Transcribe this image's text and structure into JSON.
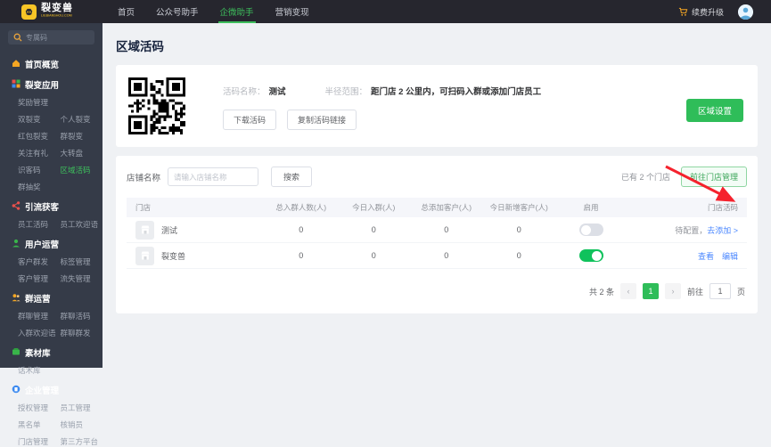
{
  "header": {
    "logo_title": "裂变兽",
    "logo_subtitle": "LIEBIANSHOU.COM",
    "nav": [
      {
        "label": "首页",
        "active": false
      },
      {
        "label": "公众号助手",
        "active": false
      },
      {
        "label": "企微助手",
        "active": true
      },
      {
        "label": "营销变现",
        "active": false
      }
    ],
    "upgrade_label": "续费升级",
    "cart_icon": "cart-icon",
    "avatar_icon": "user-avatar"
  },
  "sidebar": {
    "search_placeholder": "专属码",
    "search_icon": "search-icon",
    "active_item": "区域活码",
    "sections": [
      {
        "title": "首页概览",
        "icon": "home-icon",
        "rows": []
      },
      {
        "title": "裂变应用",
        "icon": "apps-icon",
        "rows": [
          [
            "奖励管理"
          ],
          [
            "双裂变",
            "个人裂变"
          ],
          [
            "红包裂变",
            "群裂变"
          ],
          [
            "关注有礼",
            "大转盘"
          ],
          [
            "识客码",
            "区域活码"
          ],
          [
            "群抽奖"
          ]
        ]
      },
      {
        "title": "引流获客",
        "icon": "traffic-icon",
        "rows": [
          [
            "员工活码",
            "员工欢迎语"
          ]
        ]
      },
      {
        "title": "用户运营",
        "icon": "users-icon",
        "rows": [
          [
            "客户群发",
            "标签管理"
          ],
          [
            "客户管理",
            "流失管理"
          ]
        ]
      },
      {
        "title": "群运营",
        "icon": "group-icon",
        "rows": [
          [
            "群聊管理",
            "群聊活码"
          ],
          [
            "入群欢迎语",
            "群聊群发"
          ]
        ]
      },
      {
        "title": "素材库",
        "icon": "material-icon",
        "rows": [
          [
            "话术库"
          ]
        ]
      },
      {
        "title": "企业管理",
        "icon": "enterprise-icon",
        "rows": [
          [
            "授权管理",
            "员工管理"
          ],
          [
            "黑名单",
            "核销员"
          ],
          [
            "门店管理",
            "第三方平台"
          ]
        ]
      }
    ]
  },
  "main": {
    "page_title": "区域活码",
    "qr_card": {
      "qr_icon": "qr-code-image",
      "name_label": "活码名称：",
      "name_value": "测试",
      "radius_label": "半径范围：",
      "radius_value": "距门店 2 公里内，可扫码入群或添加门店员工",
      "download_label": "下载活码",
      "copy_label": "复制活码链接",
      "settings_label": "区域设置"
    },
    "store_card": {
      "filter_label": "店铺名称",
      "input_placeholder": "请输入店铺名称",
      "search_label": "搜索",
      "count_text": "已有 2 个门店",
      "manage_label": "前往门店管理"
    },
    "table": {
      "columns": [
        "门店",
        "总入群人数(人)",
        "今日入群(人)",
        "总添加客户(人)",
        "今日新增客户(人)",
        "启用",
        "门店活码"
      ],
      "rows": [
        {
          "name": "测试",
          "values": [
            "0",
            "0",
            "0",
            "0"
          ],
          "enabled": false,
          "pending_text": "待配置，",
          "add_link": "去添加 >"
        },
        {
          "name": "裂变兽",
          "values": [
            "0",
            "0",
            "0",
            "0"
          ],
          "enabled": true,
          "view_link": "查看",
          "edit_link": "编辑"
        }
      ]
    },
    "pagination": {
      "total_text": "共 2 条",
      "prev_icon": "chevron-left-icon",
      "next_icon": "chevron-right-icon",
      "current_page": "1",
      "goto_label": "前往",
      "goto_value": "1",
      "page_unit": "页"
    },
    "annotation": {
      "arrow_color": "#f5222d",
      "arrow_icon": "red-annotation-arrow"
    }
  },
  "colors": {
    "accent_green": "#2fbd59",
    "link_blue": "#4c88ff",
    "brand_yellow": "#f8c526",
    "topbar_dark": "#26262e",
    "sidebar_dark": "#353b48"
  }
}
